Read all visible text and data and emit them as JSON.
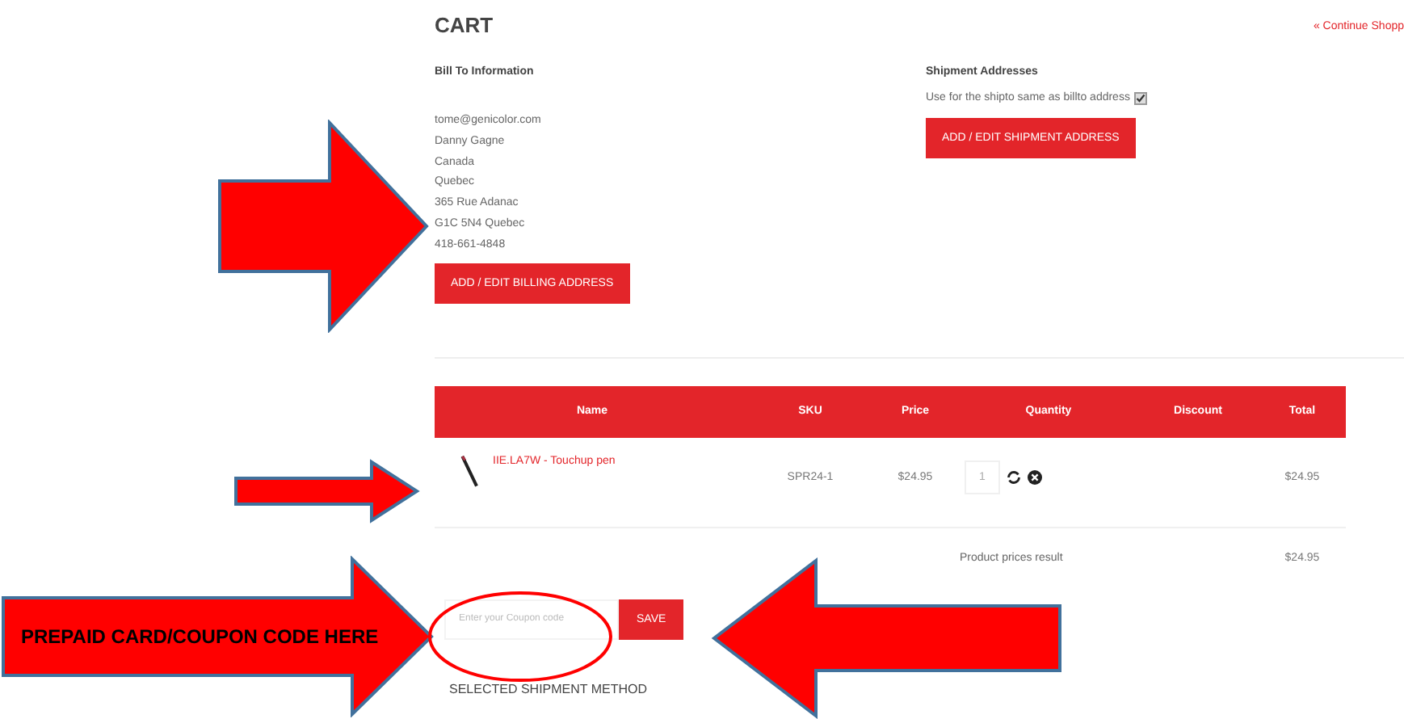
{
  "title": "CART",
  "continue_link": "« Continue Shopp",
  "billing": {
    "heading": "Bill To Information",
    "lines": [
      "tome@genicolor.com",
      "Danny Gagne",
      "Canada",
      "Quebec",
      "365 Rue Adanac",
      "G1C 5N4 Quebec",
      "418-661-4848"
    ],
    "button": "ADD / EDIT BILLING ADDRESS"
  },
  "shipment": {
    "heading": "Shipment Addresses",
    "checkbox_label": "Use for the shipto same as billto address",
    "checked": true,
    "button": "ADD / EDIT SHIPMENT ADDRESS"
  },
  "table": {
    "columns": [
      "Name",
      "SKU",
      "Price",
      "Quantity",
      "Discount",
      "Total"
    ],
    "rows": [
      {
        "name": "IIE.LA7W - Touchup pen",
        "sku": "SPR24-1",
        "price": "$24.95",
        "quantity": "1",
        "total": "$24.95"
      }
    ]
  },
  "summary": {
    "label": "Product prices result",
    "value": "$24.95"
  },
  "coupon": {
    "placeholder": "Enter your Coupon code",
    "button": "SAVE"
  },
  "shipment_method_heading": "SELECTED SHIPMENT METHOD",
  "annotation": {
    "label": "PREPAID CARD/COUPON CODE HERE"
  }
}
